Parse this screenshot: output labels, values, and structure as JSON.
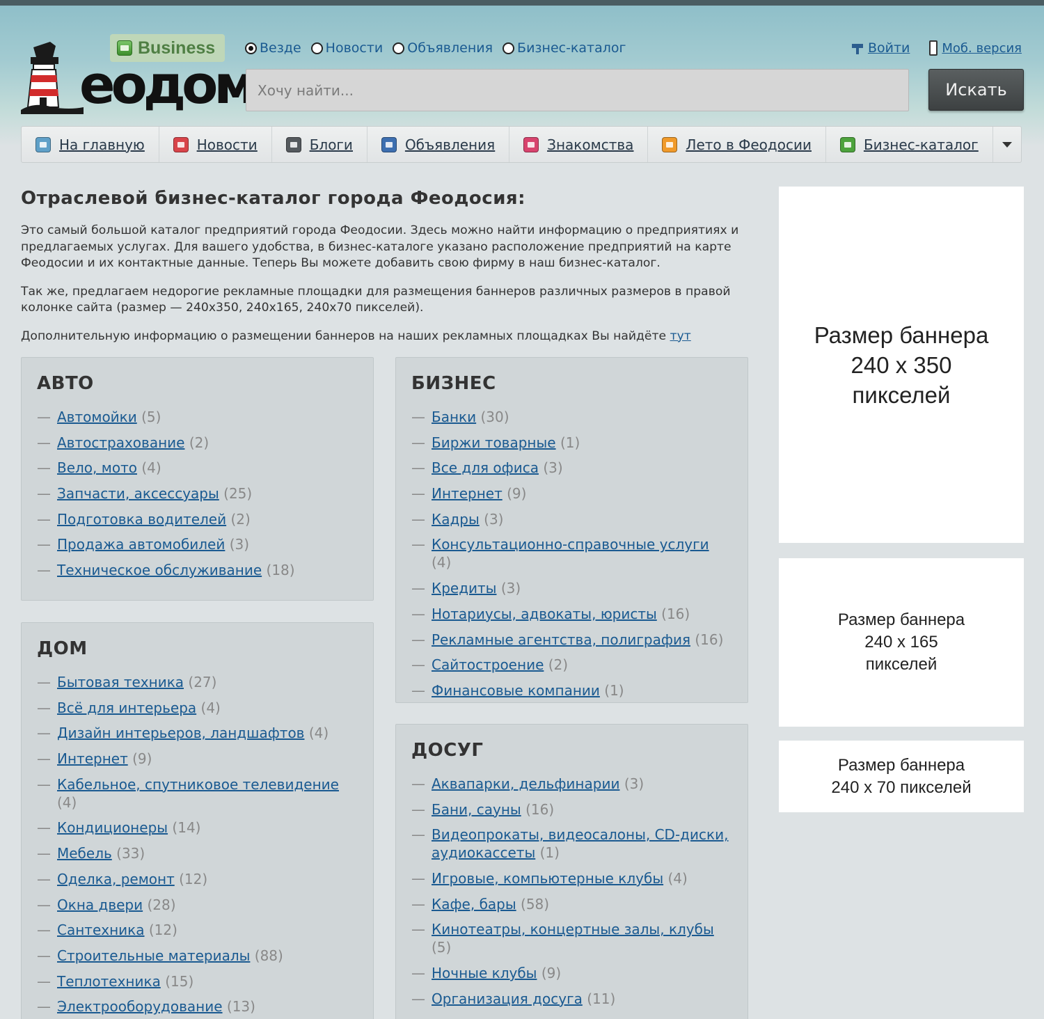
{
  "header": {
    "logo_text": "еодом",
    "business_badge": "Business",
    "scopes": [
      {
        "label": "Везде",
        "checked": true
      },
      {
        "label": "Новости",
        "checked": false
      },
      {
        "label": "Объявления",
        "checked": false
      },
      {
        "label": "Бизнес-каталог",
        "checked": false
      }
    ],
    "login": "Войти",
    "mobile": "Моб. версия",
    "search_placeholder": "Хочу найти...",
    "search_button": "Искать"
  },
  "nav": [
    {
      "label": "На главную",
      "icon": "home-icon",
      "color": "#5fa0c8"
    },
    {
      "label": "Новости",
      "icon": "news-icon",
      "color": "#d8444a"
    },
    {
      "label": "Блоги",
      "icon": "blog-icon",
      "color": "#555a5e"
    },
    {
      "label": "Объявления",
      "icon": "ads-icon",
      "color": "#3d6fb0"
    },
    {
      "label": "Знакомства",
      "icon": "heart-icon",
      "color": "#d8446e"
    },
    {
      "label": "Лето в Феодосии",
      "icon": "sun-icon",
      "color": "#f09a2a"
    },
    {
      "label": "Бизнес-каталог",
      "icon": "catalog-icon",
      "color": "#4da33d"
    }
  ],
  "main": {
    "title": "Отраслевой бизнес-каталог города Феодосия:",
    "intro_1": "Это самый большой каталог предприятий  города Феодосии. Здесь можно найти  информацию о предприятиях и предлагаемых услугах. Для вашего удобства, в бизнес-каталоге указано расположение предприятий на карте Феодосии и их контактные данные. Теперь Вы можете добавить свою фирму в наш бизнес-каталог.",
    "intro_2": "Так же, предлагаем недорогие рекламные площадки для размещения баннеров различных размеров в правой колонке сайта (размер — 240x350, 240x165, 240x70 пикселей).",
    "intro_3": "Дополнительную информацию о размещении баннеров на наших рекламных площадках Вы найдёте",
    "intro_link": "тут"
  },
  "categories": {
    "auto": {
      "title": "АВТО",
      "items": [
        {
          "name": "Автомойки",
          "count": "(5)"
        },
        {
          "name": "Автострахование",
          "count": "(2)"
        },
        {
          "name": "Вело, мото",
          "count": "(4)"
        },
        {
          "name": "Запчасти, аксессуары",
          "count": "(25)"
        },
        {
          "name": "Подготовка водителей",
          "count": "(2)"
        },
        {
          "name": "Продажа автомобилей",
          "count": "(3)"
        },
        {
          "name": "Техническое обслуживание",
          "count": "(18)"
        }
      ]
    },
    "business": {
      "title": "БИЗНЕС",
      "items": [
        {
          "name": "Банки",
          "count": "(30)"
        },
        {
          "name": "Биржи товарные",
          "count": "(1)"
        },
        {
          "name": "Все для офиса",
          "count": "(3)"
        },
        {
          "name": "Интернет",
          "count": "(9)"
        },
        {
          "name": "Кадры",
          "count": "(3)"
        },
        {
          "name": "Консультационно-справочные услуги",
          "count": "(4)"
        },
        {
          "name": "Кредиты",
          "count": "(3)"
        },
        {
          "name": "Нотариусы, адвокаты, юристы",
          "count": "(16)"
        },
        {
          "name": "Рекламные агентства, полиграфия",
          "count": "(16)"
        },
        {
          "name": "Сайтостроение",
          "count": "(2)"
        },
        {
          "name": "Финансовые компании",
          "count": "(1)"
        }
      ]
    },
    "home": {
      "title": "ДОМ",
      "items": [
        {
          "name": "Бытовая техника",
          "count": "(27)"
        },
        {
          "name": "Всё для интерьера",
          "count": "(4)"
        },
        {
          "name": "Дизайн интерьеров, ландшафтов",
          "count": "(4)"
        },
        {
          "name": "Интернет",
          "count": "(9)"
        },
        {
          "name": "Кабельное, спутниковое телевидение",
          "count": "(4)"
        },
        {
          "name": "Кондиционеры",
          "count": "(14)"
        },
        {
          "name": "Мебель",
          "count": "(33)"
        },
        {
          "name": "Оделка, ремонт",
          "count": "(12)"
        },
        {
          "name": "Окна двери",
          "count": "(28)"
        },
        {
          "name": "Сантехника",
          "count": "(12)"
        },
        {
          "name": "Строительные материалы",
          "count": "(88)"
        },
        {
          "name": "Теплотехника",
          "count": "(15)"
        },
        {
          "name": "Электрооборудование",
          "count": "(13)"
        }
      ]
    },
    "leisure": {
      "title": "ДОСУГ",
      "items": [
        {
          "name": "Аквапарки, дельфинарии",
          "count": "(3)"
        },
        {
          "name": "Бани, сауны",
          "count": "(16)"
        },
        {
          "name": "Видеопрокаты, видеосалоны, CD-диски, аудиокассеты",
          "count": "(1)"
        },
        {
          "name": "Игровые, компьютерные клубы",
          "count": "(4)"
        },
        {
          "name": "Кафе, бары",
          "count": "(58)"
        },
        {
          "name": "Кинотеатры, концертные залы, клубы",
          "count": "(5)"
        },
        {
          "name": "Ночные клубы",
          "count": "(9)"
        },
        {
          "name": "Организация досуга",
          "count": "(11)"
        }
      ]
    }
  },
  "banners": [
    {
      "lines": [
        "Размер баннера",
        "240 x 350",
        "пикселей"
      ]
    },
    {
      "lines": [
        "Размер баннера",
        "240 x 165",
        "пикселей"
      ]
    },
    {
      "lines": [
        "Размер баннера",
        "240 x 70 пикселей"
      ]
    }
  ]
}
